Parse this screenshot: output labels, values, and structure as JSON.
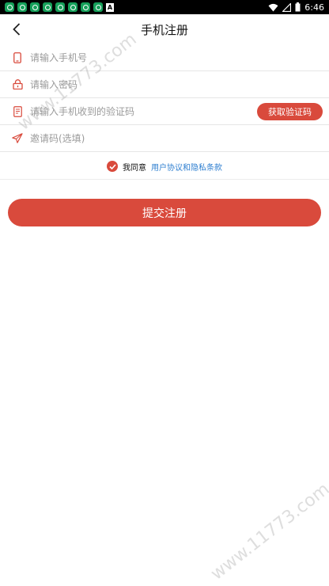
{
  "status_bar": {
    "time": "6:46",
    "notification_icons": [
      "app-icon",
      "app-icon",
      "app-icon",
      "app-icon",
      "app-icon",
      "app-icon",
      "app-icon",
      "app-icon"
    ],
    "accessibility_badge": "A"
  },
  "header": {
    "title": "手机注册"
  },
  "form": {
    "phone": {
      "placeholder": "请输入手机号",
      "value": ""
    },
    "password": {
      "placeholder": "请输入密码",
      "value": ""
    },
    "sms_code": {
      "placeholder": "请输入手机收到的验证码",
      "value": "",
      "button_label": "获取验证码"
    },
    "invite_code": {
      "placeholder": "邀请码(选填)",
      "value": ""
    }
  },
  "agreement": {
    "checked": true,
    "label": "我同意",
    "link_text": "用户协议和隐私条款"
  },
  "submit_label": "提交注册",
  "watermark": "www.11773.com",
  "colors": {
    "accent": "#d94a3c",
    "link": "#2f7fd0"
  }
}
